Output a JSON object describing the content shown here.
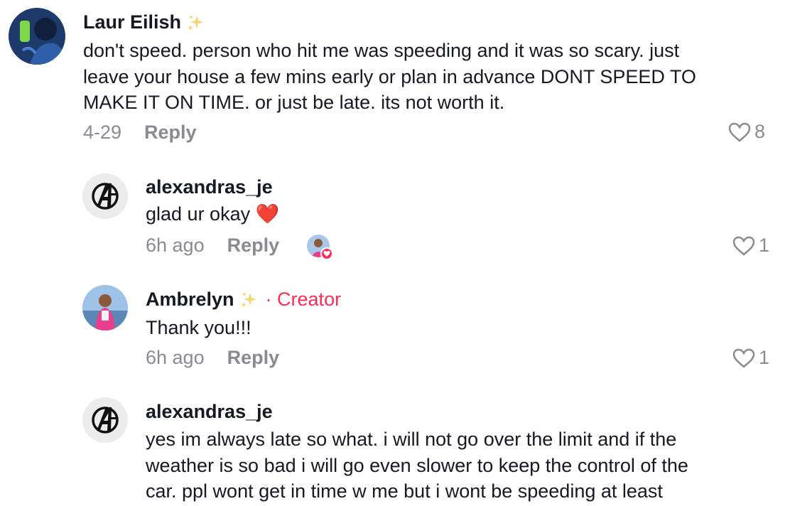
{
  "comments": [
    {
      "username": "Laur Eilish",
      "text_lines": [
        "don't speed. person who hit me was speeding and it was so scary. just",
        "leave your house a few mins early or plan in advance DONT SPEED TO",
        "MAKE IT ON TIME. or just be late. its not worth it."
      ],
      "date": "4-29",
      "reply_label": "Reply",
      "likes": "8"
    }
  ],
  "replies": [
    {
      "username": "alexandras_je",
      "text_lines": [
        "glad ur okay ❤️"
      ],
      "date": "6h ago",
      "reply_label": "Reply",
      "likes": "1",
      "liked_by_creator": true
    },
    {
      "username": "Ambrelyn",
      "creator_badge": "· Creator",
      "text_lines": [
        "Thank you!!!"
      ],
      "date": "6h ago",
      "reply_label": "Reply",
      "likes": "1"
    },
    {
      "username": "alexandras_je",
      "text_lines": [
        "yes im always late so what. i will not go over the limit and if the",
        "weather is so bad i will go even slower to keep the control of the",
        "car. ppl wont get in time w me but i wont be speeding at least"
      ]
    }
  ],
  "colors": {
    "accent": "#fe2c55",
    "secondary_text": "#8a8b91",
    "primary_text": "#161823"
  }
}
